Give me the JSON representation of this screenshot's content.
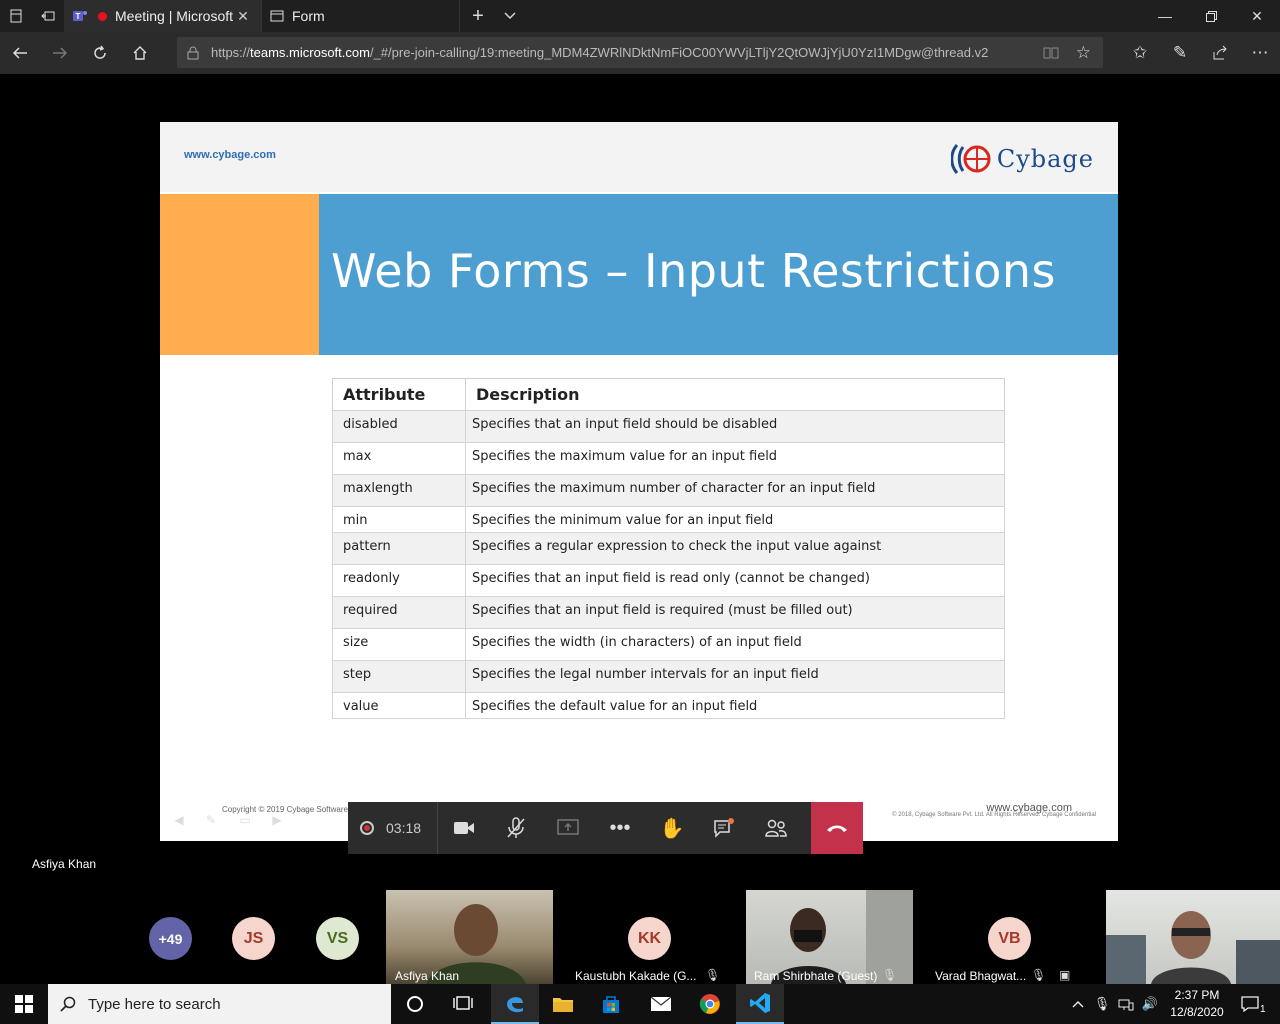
{
  "browser": {
    "tabs": [
      {
        "label": "Meeting | Microsoft",
        "recording": true,
        "icon": "teams-icon"
      },
      {
        "label": "Form",
        "icon": "page-icon"
      }
    ],
    "url_prefix": "https://",
    "url_domain": "teams.microsoft.com",
    "url_rest": "/_#/pre-join-calling/19:meeting_MDM4ZWRlNDktNmFiOC00YWVjLTljY2QtOWJjYjU0YzI1MDgw@thread.v2"
  },
  "slide": {
    "site_link": "www.cybage.com",
    "logo_text": "Cybage",
    "title": "Web Forms – Input Restrictions",
    "table": {
      "headers": [
        "Attribute",
        "Description"
      ],
      "rows": [
        {
          "attr": "disabled",
          "desc": "Specifies that an input field should be disabled"
        },
        {
          "attr": "max",
          "desc": "Specifies the maximum  value for an input field"
        },
        {
          "attr": "maxlength",
          "desc": "Specifies the maximum  number  of character for an input field"
        },
        {
          "attr": "min",
          "desc": "Specifies the minimum  value for an input field"
        },
        {
          "attr": "pattern",
          "desc": "Specifies a regular expression to check the input value against"
        },
        {
          "attr": "readonly",
          "desc": "Specifies that an input field is read only (cannot be changed)"
        },
        {
          "attr": "required",
          "desc": "Specifies that an input field is required (must be filled out)"
        },
        {
          "attr": "size",
          "desc": "Specifies the width (in characters) of an input field"
        },
        {
          "attr": "step",
          "desc": "Specifies the legal number intervals for an input field"
        },
        {
          "attr": "value",
          "desc": "Specifies the default value for an input field"
        }
      ]
    },
    "copyright": "Copyright © 2019 Cybage Software",
    "footer_link": "www.cybage.com",
    "footer_small": "© 2018, Cybage Software Pvt. Ltd. All Rights Reserved. Cybage Confidential"
  },
  "meeting": {
    "timer": "03:18",
    "presenter": "Asfiya Khan",
    "participants": {
      "overflow": "+49",
      "avatars": [
        {
          "initials": "JS",
          "bg": "#f5d5cc",
          "fg": "#a33a2b"
        },
        {
          "initials": "VS",
          "bg": "#dfe8d0",
          "fg": "#4a6b20"
        },
        {
          "initials": "KK",
          "bg": "#f5d5cc",
          "fg": "#a33a2b"
        },
        {
          "initials": "VB",
          "bg": "#f5d5cc",
          "fg": "#a33a2b"
        }
      ],
      "names": {
        "asfiya": "Asfiya Khan",
        "kaustubh": "Kaustubh Kakade (G...",
        "ram": "Ram Shirbhate (Guest)",
        "varad": "Varad Bhagwat..."
      }
    }
  },
  "taskbar": {
    "search_placeholder": "Type here to search",
    "time": "2:37 PM",
    "date": "12/8/2020",
    "notification_count": "1"
  },
  "colors": {
    "title_band": "#4c9fd0",
    "orange_block": "#ffad4f",
    "hangup": "#c4314b",
    "overflow_avatar": "#6264a7"
  }
}
